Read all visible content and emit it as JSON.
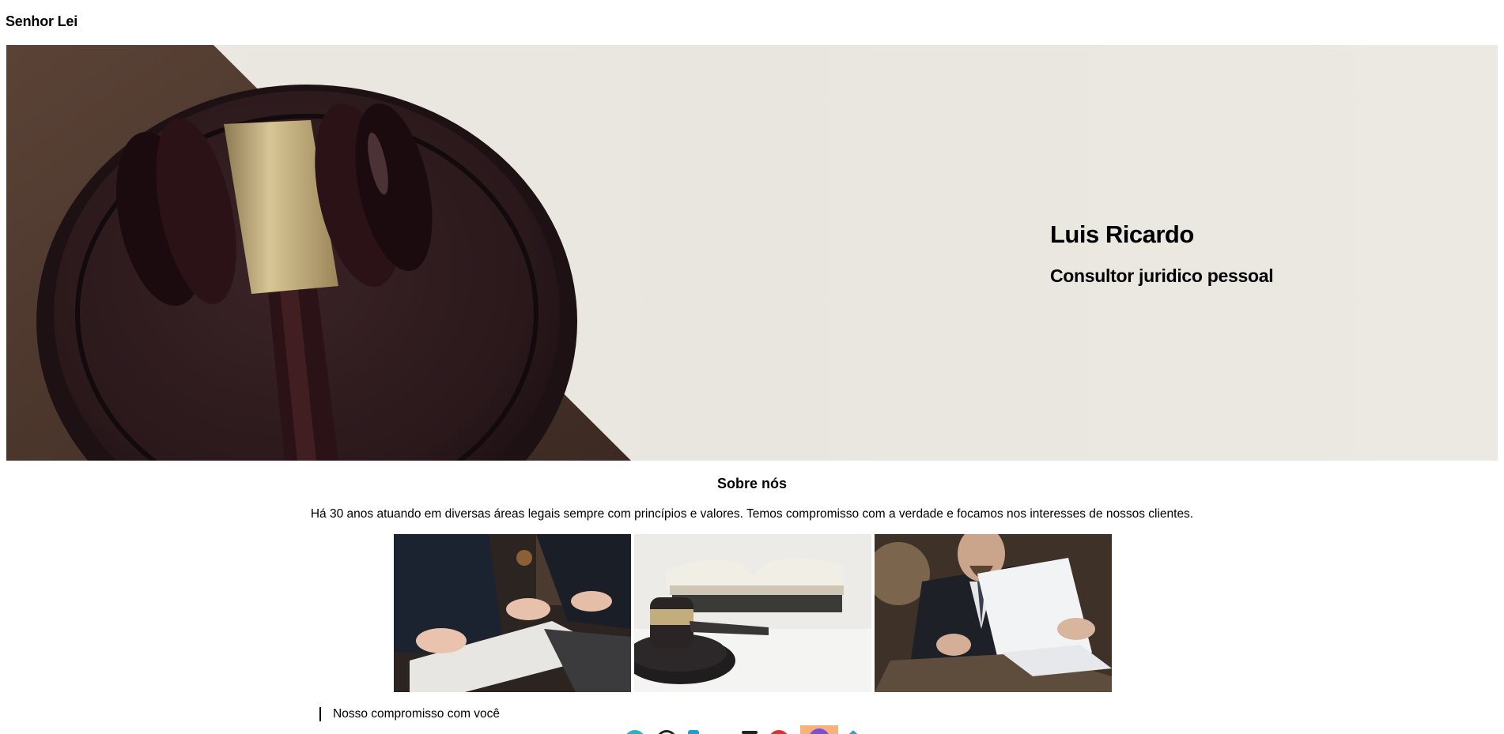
{
  "header": {
    "site_title": "Senhor Lei"
  },
  "hero": {
    "name": "Luis Ricardo",
    "role": "Consultor juridico pessoal"
  },
  "about": {
    "title": "Sobre nós",
    "text": "Há 30 anos atuando em diversas áreas legais sempre com princípios e valores. Temos compromisso com a verdade e focamos nos interesses de nossos clientes."
  },
  "commitment": {
    "label": "Nosso compromisso com você"
  },
  "social_icons": [
    {
      "name": "whatsapp-icon",
      "color": "#19b5c8"
    },
    {
      "name": "github-icon",
      "color": "#222222"
    },
    {
      "name": "twitter-icon",
      "color": "#1c9ed8"
    },
    {
      "name": "linkedin-icon",
      "color": "#ffffff"
    },
    {
      "name": "email-icon",
      "color": "#222222"
    },
    {
      "name": "youtube-icon",
      "color": "#e0302a"
    },
    {
      "name": "instagram-icon",
      "color": "#7b4fd9"
    },
    {
      "name": "telegram-icon",
      "color": "#2aa4d8"
    }
  ]
}
